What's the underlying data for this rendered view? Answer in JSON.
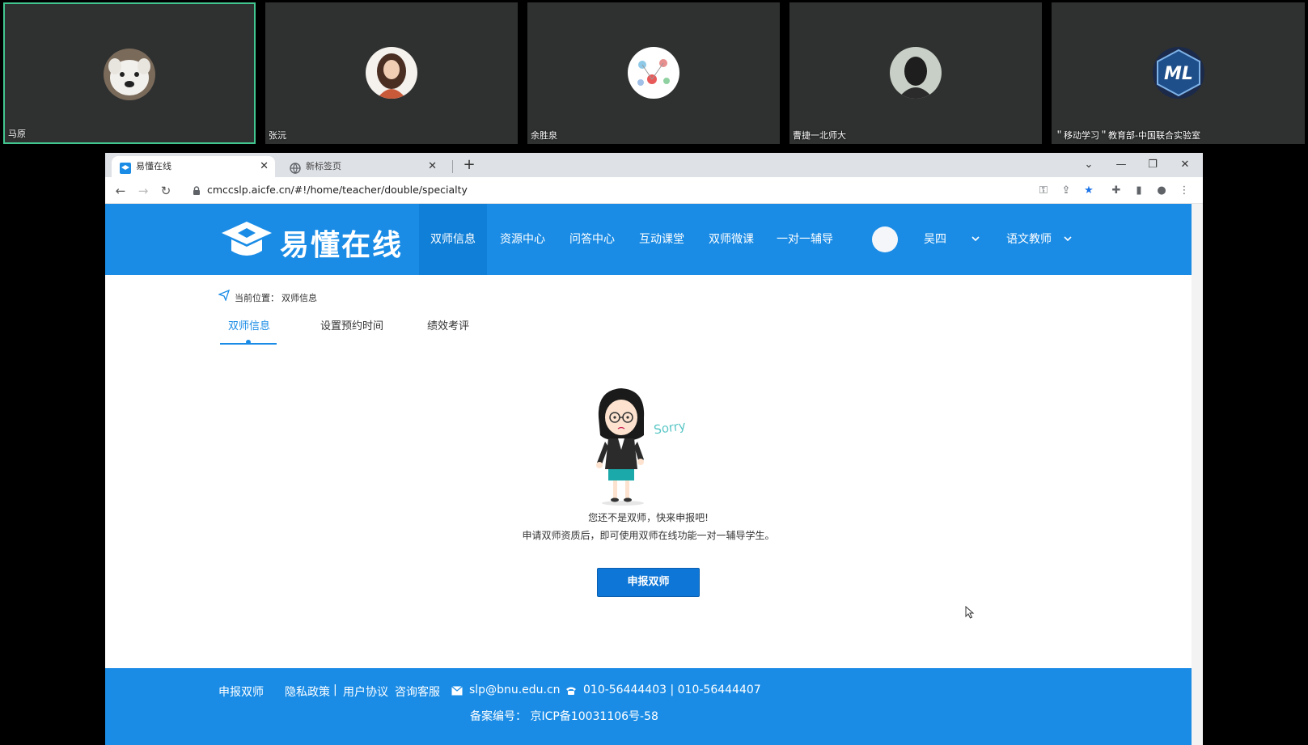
{
  "participants": [
    {
      "name": "马原",
      "avatar_icon": "dog-avatar-icon",
      "active": true
    },
    {
      "name": "张沅",
      "avatar_icon": "woman-avatar-icon",
      "active": false
    },
    {
      "name": "余胜泉",
      "avatar_icon": "diagram-avatar-icon",
      "active": false
    },
    {
      "name": "曹捷一北师大",
      "avatar_icon": "person-back-avatar-icon",
      "active": false
    },
    {
      "name": "＂移动学习＂教育部-中国联合实验室",
      "avatar_icon": "ml-logo-avatar-icon",
      "active": false
    }
  ],
  "browser": {
    "tabs": [
      {
        "title": "易懂在线",
        "active": true
      },
      {
        "title": "新标签页",
        "active": false
      }
    ],
    "url": "cmccslp.aicfe.cn/#!/home/teacher/double/specialty"
  },
  "site": {
    "logo_text": "易懂在线",
    "nav": [
      "双师信息",
      "资源中心",
      "问答中心",
      "互动课堂",
      "双师微课",
      "一对一辅导"
    ],
    "user_name": "吴四",
    "role": "语文教师"
  },
  "breadcrumb": {
    "label": "当前位置：",
    "value": "双师信息"
  },
  "subtabs": [
    "双师信息",
    "设置预约时间",
    "绩效考评"
  ],
  "empty_state": {
    "sorry_text": "Sorry",
    "line1": "您还不是双师，快来申报吧!",
    "line2": "申请双师资质后，即可使用双师在线功能一对一辅导学生。",
    "button": "申报双师"
  },
  "footer": {
    "apply": "申报双师",
    "privacy": "隐私政策",
    "sep": "|",
    "agreement": "用户协议",
    "support": "咨询客服",
    "email": "slp@bnu.edu.cn",
    "phone": "010-56444403 | 010-56444407",
    "icp": "备案编号：  京ICP备10031106号-58"
  },
  "colors": {
    "brand_blue": "#1a8ce6",
    "button_blue": "#0d76d6",
    "active_border": "#42c690"
  }
}
